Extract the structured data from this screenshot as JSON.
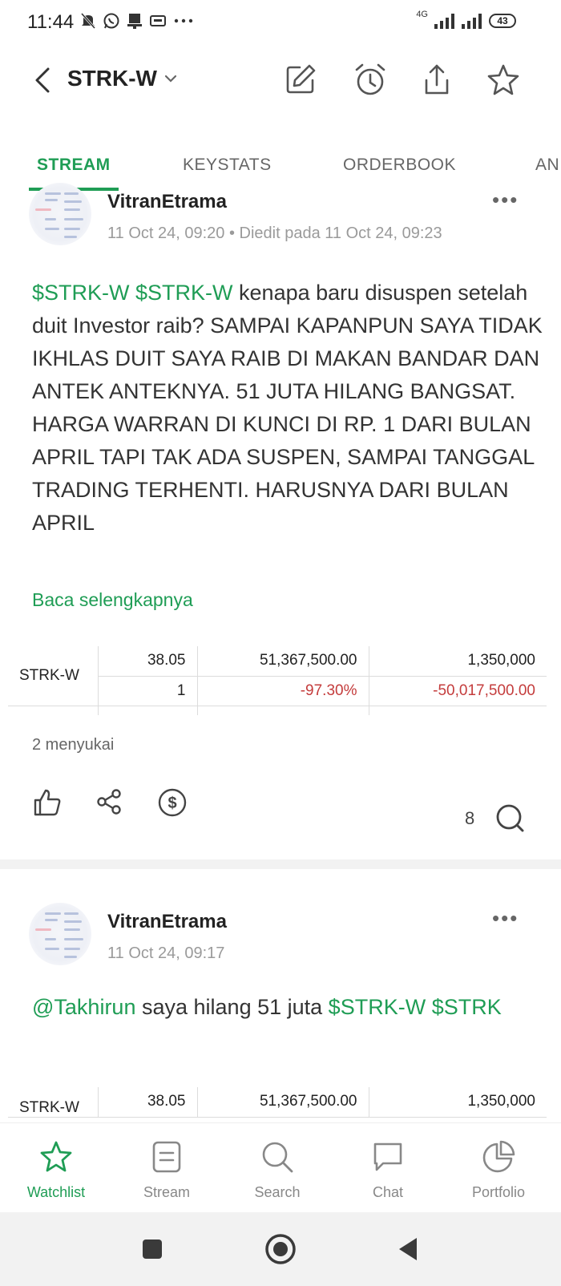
{
  "status_bar": {
    "time": "11:44",
    "network": "4G",
    "battery": "43"
  },
  "header": {
    "title": "STRK-W"
  },
  "tabs": [
    {
      "label": "STREAM",
      "active": true
    },
    {
      "label": "KEYSTATS",
      "active": false
    },
    {
      "label": "ORDERBOOK",
      "active": false
    },
    {
      "label": "AN",
      "active": false
    }
  ],
  "posts": [
    {
      "username": "VitranEtrama",
      "time": "11 Oct 24, 09:20",
      "edited": "• Diedit pada 11 Oct 24, 09:23",
      "body": {
        "tag1": "$STRK-W",
        "tag2": "$STRK-W",
        "text": "kenapa baru disuspen setelah duit Investor raib? SAMPAI KAPANPUN SAYA TIDAK IKHLAS DUIT SAYA RAIB DI MAKAN BANDAR DAN ANTEK ANTEKNYA. 51 JUTA HILANG BANGSAT. HARGA WARRAN DI KUNCI DI RP. 1 DARI BULAN APRIL TAPI TAK ADA SUSPEN, SAMPAI TANGGAL TRADING TERHENTI. HARUSNYA DARI BULAN APRIL"
      },
      "read_more": "Baca selengkapnya",
      "table": {
        "label": "STRK-W",
        "row1": [
          "38.05",
          "51,367,500.00",
          "1,350,000"
        ],
        "row2": [
          "1",
          "-97.30%",
          "-50,017,500.00"
        ]
      },
      "likes": "2 menyukai",
      "comment_count": "8"
    },
    {
      "username": "VitranEtrama",
      "time": "11 Oct 24, 09:17",
      "body": {
        "mention": "@Takhirun",
        "text": "saya hilang 51 juta",
        "tag1": "$STRK-W",
        "tag2": "$STRK"
      },
      "table": {
        "label": "STRK-W",
        "row1": [
          "38.05",
          "51,367,500.00",
          "1,350,000"
        ]
      }
    }
  ],
  "bottom_nav": [
    {
      "label": "Watchlist",
      "icon": "star-icon",
      "active": true
    },
    {
      "label": "Stream",
      "icon": "stream-icon",
      "active": false
    },
    {
      "label": "Search",
      "icon": "search-icon",
      "active": false
    },
    {
      "label": "Chat",
      "icon": "chat-icon",
      "active": false
    },
    {
      "label": "Portfolio",
      "icon": "pie-chart-icon",
      "active": false
    }
  ],
  "colors": {
    "accent": "#1f9d55",
    "negative": "#c43c3c"
  }
}
